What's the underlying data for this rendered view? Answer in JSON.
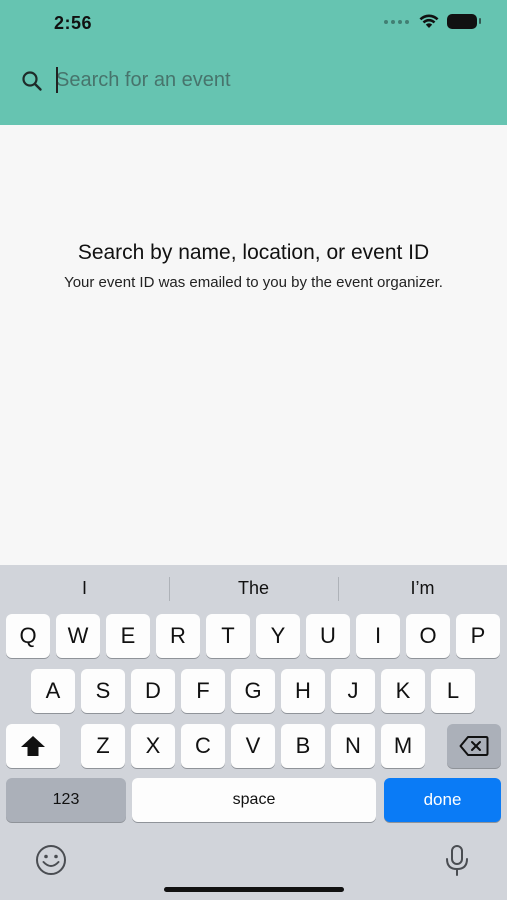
{
  "status_bar": {
    "time": "2:56"
  },
  "search": {
    "placeholder": "Search for an event",
    "value": ""
  },
  "empty_state": {
    "title": "Search by name, location, or event ID",
    "subtitle": "Your event ID was emailed to you by the event organizer."
  },
  "keyboard": {
    "suggestions": [
      "I",
      "The",
      "I’m"
    ],
    "row1": [
      "Q",
      "W",
      "E",
      "R",
      "T",
      "Y",
      "U",
      "I",
      "O",
      "P"
    ],
    "row2": [
      "A",
      "S",
      "D",
      "F",
      "G",
      "H",
      "J",
      "K",
      "L"
    ],
    "row3": [
      "Z",
      "X",
      "C",
      "V",
      "B",
      "N",
      "M"
    ],
    "numbers_key": "123",
    "space_key": "space",
    "done_key": "done"
  },
  "colors": {
    "header": "#66c4b1",
    "done_key": "#0a7bf6",
    "keyboard_bg": "#d1d4da"
  }
}
